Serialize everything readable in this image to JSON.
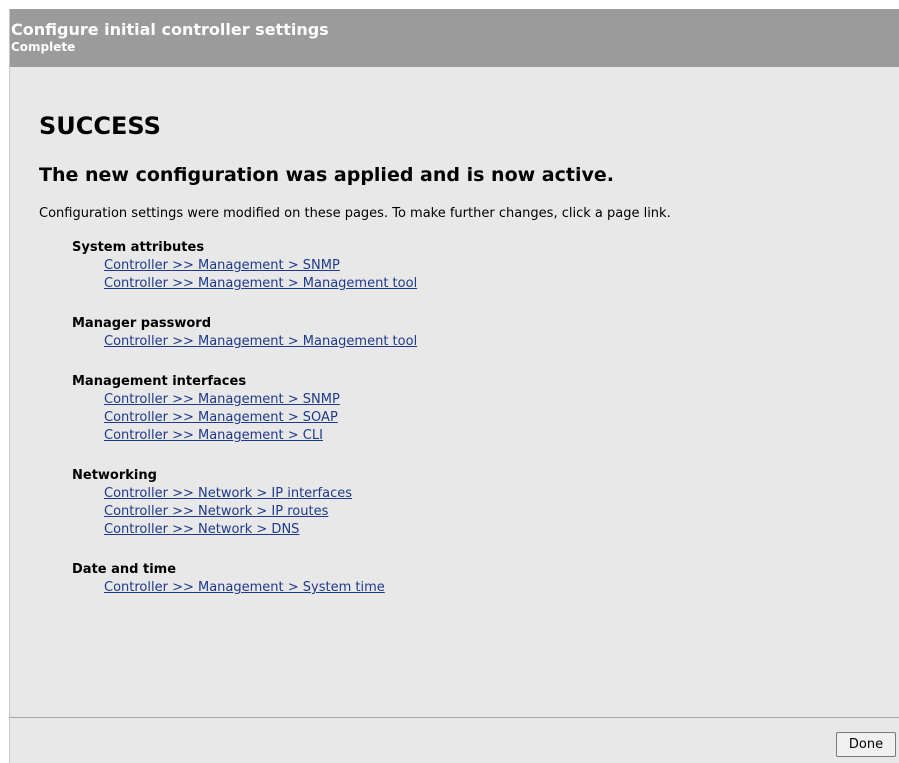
{
  "header": {
    "title": "Configure initial controller settings",
    "subtitle": "Complete"
  },
  "main": {
    "heading": "SUCCESS",
    "subheading": "The new configuration was applied and is now active.",
    "intro": "Configuration settings were modified on these pages. To make further changes, click a page link.",
    "sections": [
      {
        "title": "System attributes",
        "links": [
          "Controller >> Management > SNMP",
          "Controller >> Management > Management tool"
        ]
      },
      {
        "title": "Manager password",
        "links": [
          "Controller >> Management > Management tool"
        ]
      },
      {
        "title": "Management interfaces",
        "links": [
          "Controller >> Management > SNMP",
          "Controller >> Management > SOAP",
          "Controller >> Management > CLI"
        ]
      },
      {
        "title": "Networking",
        "links": [
          "Controller >> Network > IP interfaces",
          "Controller >> Network > IP routes",
          "Controller >> Network > DNS"
        ]
      },
      {
        "title": "Date and time",
        "links": [
          "Controller >> Management > System time"
        ]
      }
    ]
  },
  "footer": {
    "done_label": "Done"
  },
  "colors": {
    "header_bg": "#9b9b9b",
    "panel_bg": "#e8e8e8",
    "link": "#1f3a8a"
  }
}
